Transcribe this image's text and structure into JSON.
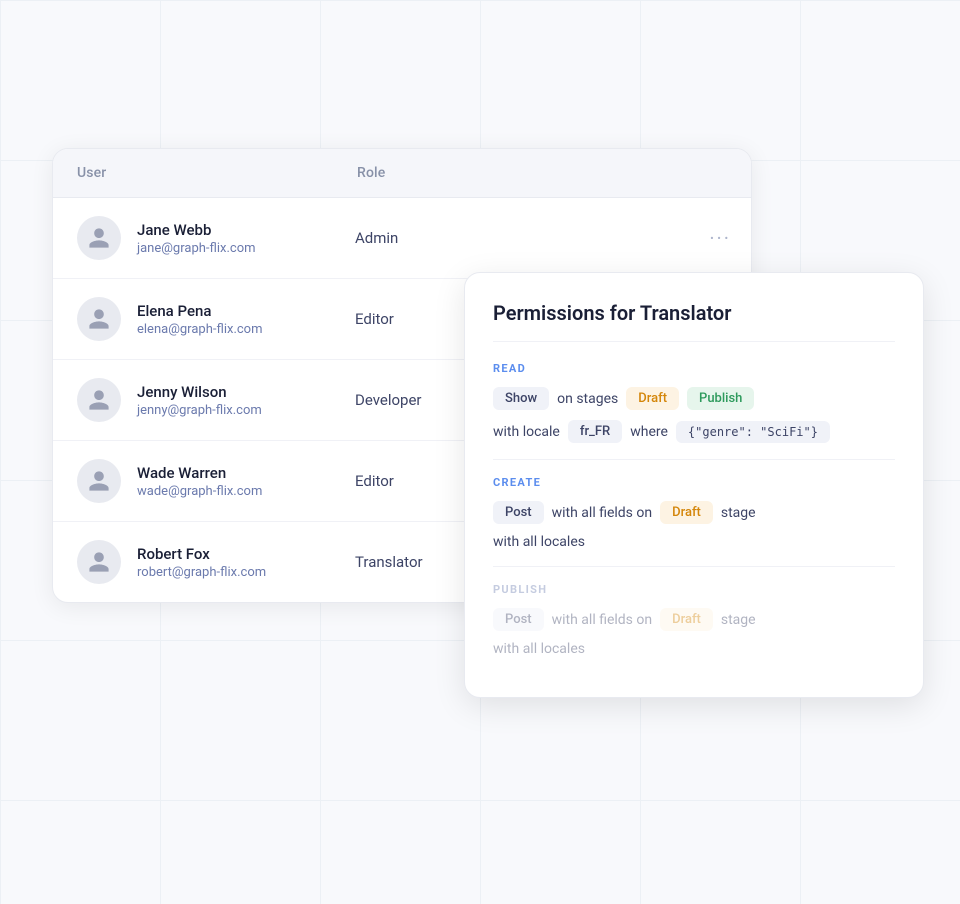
{
  "background": {
    "grid_color": "#e2e8f0"
  },
  "users_table": {
    "columns": {
      "user": "User",
      "role": "Role"
    },
    "rows": [
      {
        "name": "Jane Webb",
        "email": "jane@graph-flix.com",
        "role": "Admin",
        "show_actions": true
      },
      {
        "name": "Elena Pena",
        "email": "elena@graph-flix.com",
        "role": "Editor",
        "show_actions": false
      },
      {
        "name": "Jenny Wilson",
        "email": "jenny@graph-flix.com",
        "role": "Developer",
        "show_actions": false
      },
      {
        "name": "Wade Warren",
        "email": "wade@graph-flix.com",
        "role": "Editor",
        "show_actions": false
      },
      {
        "name": "Robert Fox",
        "email": "robert@graph-flix.com",
        "role": "Translator",
        "show_actions": false
      }
    ]
  },
  "permissions_panel": {
    "title": "Permissions for Translator",
    "sections": {
      "read": {
        "label": "READ",
        "rows": [
          {
            "parts": [
              {
                "type": "badge",
                "variant": "show",
                "text": "Show"
              },
              {
                "type": "text",
                "text": "on stages"
              },
              {
                "type": "badge",
                "variant": "draft",
                "text": "Draft"
              },
              {
                "type": "badge",
                "variant": "publish",
                "text": "Publish"
              }
            ]
          },
          {
            "parts": [
              {
                "type": "text",
                "text": "with locale"
              },
              {
                "type": "badge",
                "variant": "locale",
                "text": "fr_FR"
              },
              {
                "type": "text",
                "text": "where"
              },
              {
                "type": "badge",
                "variant": "filter",
                "text": "{\"genre\": \"SciFi\"}"
              }
            ]
          }
        ]
      },
      "create": {
        "label": "CREATE",
        "rows": [
          {
            "parts": [
              {
                "type": "badge",
                "variant": "post",
                "text": "Post"
              },
              {
                "type": "text",
                "text": "with all fields on"
              },
              {
                "type": "badge",
                "variant": "draft",
                "text": "Draft"
              },
              {
                "type": "text",
                "text": "stage"
              }
            ]
          },
          {
            "parts": [
              {
                "type": "text",
                "text": "with all locales"
              }
            ]
          }
        ]
      },
      "publish": {
        "label": "PUBLISH",
        "disabled": true,
        "rows": [
          {
            "parts": [
              {
                "type": "badge",
                "variant": "post",
                "text": "Post"
              },
              {
                "type": "text",
                "text": "with all fields on"
              },
              {
                "type": "badge",
                "variant": "draft",
                "text": "Draft"
              },
              {
                "type": "text",
                "text": "stage"
              }
            ]
          },
          {
            "parts": [
              {
                "type": "text",
                "text": "with all locales"
              }
            ]
          }
        ]
      }
    }
  }
}
